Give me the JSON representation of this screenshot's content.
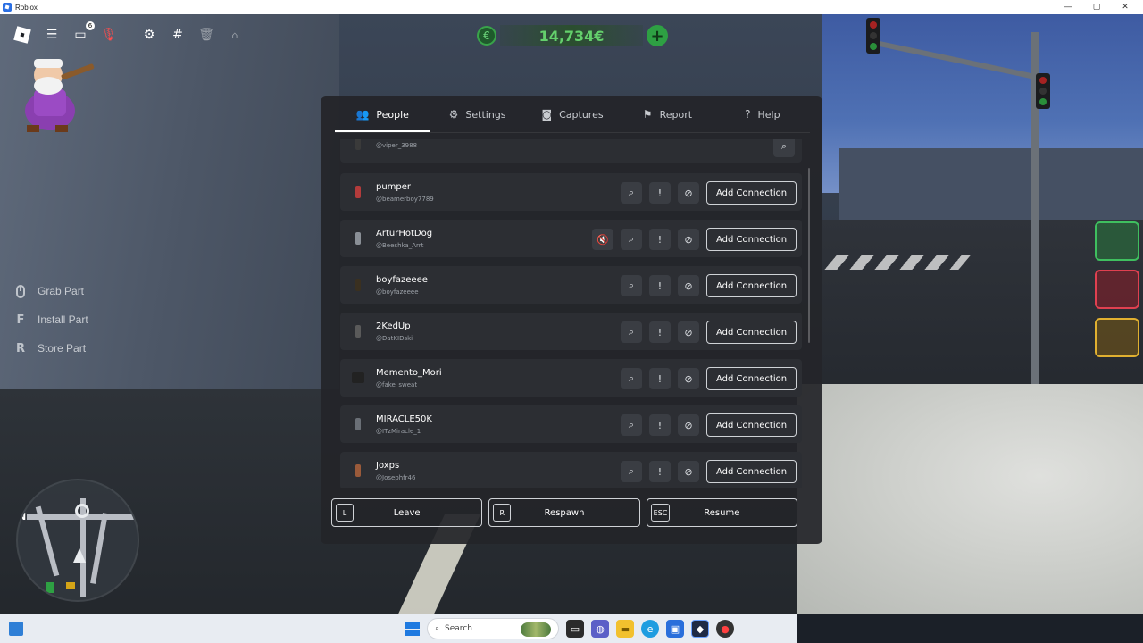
{
  "window": {
    "title": "Roblox",
    "controls": [
      "—",
      "▢",
      "✕"
    ]
  },
  "hud": {
    "money": "14,734€",
    "money_coin": "€",
    "money_plus": "+",
    "notifications_count": "6",
    "controls": [
      {
        "key": "",
        "label": "Grab Part",
        "icon": "mouse-icon"
      },
      {
        "key": "F",
        "label": "Install Part"
      },
      {
        "key": "R",
        "label": "Store Part"
      }
    ],
    "minimap_north": "N"
  },
  "menu": {
    "tabs": [
      {
        "label": "People",
        "icon": "people-icon",
        "glyph": "👥",
        "active": true
      },
      {
        "label": "Settings",
        "icon": "gear-icon",
        "glyph": "⚙"
      },
      {
        "label": "Captures",
        "icon": "camera-icon",
        "glyph": "◙"
      },
      {
        "label": "Report",
        "icon": "report-flag-icon",
        "glyph": "⚑"
      },
      {
        "label": "Help",
        "icon": "help-icon",
        "glyph": "?"
      }
    ],
    "players": [
      {
        "display": "",
        "username": "@viper_3988"
      },
      {
        "display": "pumper",
        "username": "@beamerboy7789"
      },
      {
        "display": "ArturHotDog",
        "username": "@Beeshka_Arrt",
        "muted_icon": true
      },
      {
        "display": "boyfazeeee",
        "username": "@boyfazeeee"
      },
      {
        "display": "2KedUp",
        "username": "@DatKIDski"
      },
      {
        "display": "Memento_Mori",
        "username": "@fake_sweat"
      },
      {
        "display": "MIRACLE50K",
        "username": "@ITzMiracle_1"
      },
      {
        "display": "Joxps",
        "username": "@Josephfr46"
      }
    ],
    "add_connection_label": "Add Connection",
    "bottom": {
      "leave": {
        "key": "L",
        "label": "Leave"
      },
      "respawn": {
        "key": "R",
        "label": "Respawn"
      },
      "resume": {
        "key": "ESC",
        "label": "Resume"
      }
    }
  },
  "taskbar": {
    "search_placeholder": "Search"
  },
  "colors": {
    "money_green": "#64d06c",
    "accent_blue": "#1f7ae0",
    "mute_red": "#ff5a5a"
  }
}
